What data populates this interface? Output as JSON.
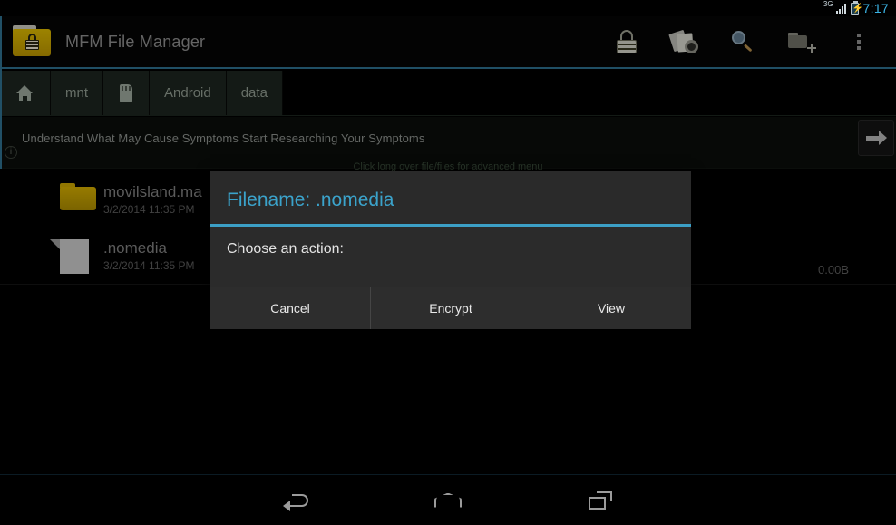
{
  "statusbar": {
    "network": "3G",
    "time": "7:17",
    "battery_icon": "battery-charging-icon",
    "signal_icon": "signal-bars-icon"
  },
  "titlebar": {
    "app_title": "MFM File Manager",
    "app_icon": "locked-folder-icon",
    "accent_color": "#2d6e8c",
    "actions": [
      {
        "name": "lock-icon",
        "label": "Lock"
      },
      {
        "name": "shred-files-icon",
        "label": "Shred"
      },
      {
        "name": "search-icon",
        "label": "Search"
      },
      {
        "name": "new-folder-icon",
        "label": "New Folder"
      },
      {
        "name": "overflow-menu-icon",
        "label": "More options"
      }
    ]
  },
  "breadcrumb": [
    {
      "type": "icon",
      "icon": "home-icon",
      "label": ""
    },
    {
      "type": "text",
      "icon": "",
      "label": "mnt"
    },
    {
      "type": "icon",
      "icon": "sdcard-icon",
      "label": ""
    },
    {
      "type": "text",
      "icon": "",
      "label": "Android"
    },
    {
      "type": "text",
      "icon": "",
      "label": "data"
    }
  ],
  "ad": {
    "text": "Understand What May Cause Symptoms Start Researching Your Symptoms",
    "info_badge": "i",
    "arrow_icon": "arrow-right-icon"
  },
  "hint": "Click long over file/files for advanced menu",
  "filelist": [
    {
      "icon": "folder-icon",
      "name": "movilsland.ma",
      "date": "3/2/2014 11:35 PM",
      "size": ""
    },
    {
      "icon": "file-icon",
      "name": ".nomedia",
      "date": "3/2/2014 11:35 PM",
      "size": "0.00B"
    }
  ],
  "dialog": {
    "title": "Filename: .nomedia",
    "message": "Choose an action:",
    "title_color": "#3ba3cb",
    "divider_color": "#3c9fc6",
    "buttons": [
      {
        "label": "Cancel"
      },
      {
        "label": "Encrypt"
      },
      {
        "label": "View"
      }
    ]
  },
  "navbar": [
    {
      "name": "nav-back-icon",
      "label": "Back"
    },
    {
      "name": "nav-home-icon",
      "label": "Home"
    },
    {
      "name": "nav-recents-icon",
      "label": "Recents"
    }
  ]
}
